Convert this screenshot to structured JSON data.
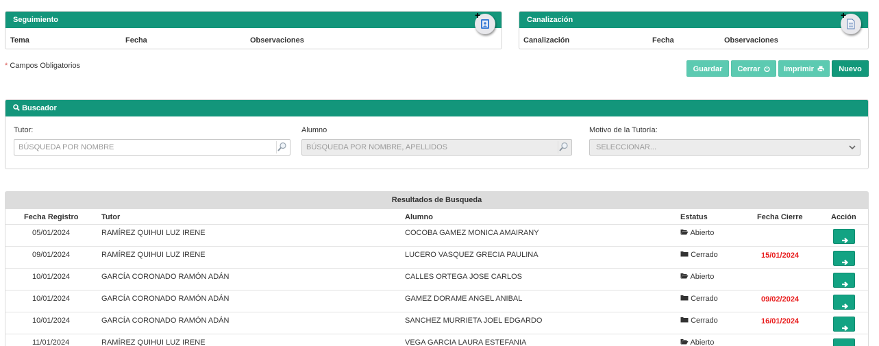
{
  "seguimiento": {
    "title": "Seguimiento",
    "columns": [
      "Tema",
      "Fecha",
      "Observaciones"
    ]
  },
  "canalizacion": {
    "title": "Canalización",
    "columns": [
      "Canalización",
      "Fecha",
      "Observaciones"
    ]
  },
  "required_note": "Campos Obligatorios",
  "toolbar": {
    "guardar": "Guardar",
    "cerrar": "Cerrar",
    "imprimir": "Imprimir",
    "nuevo": "Nuevo"
  },
  "buscador": {
    "title": "Buscador",
    "tutor_label": "Tutor:",
    "tutor_placeholder": "BÚSQUEDA POR NOMBRE",
    "alumno_label": "Alumno",
    "alumno_placeholder": "BÚSQUEDA POR NOMBRE, APELLIDOS",
    "motivo_label": "Motivo de la Tutoría:",
    "motivo_selected": "SELECCIONAR..."
  },
  "results": {
    "title": "Resultados de Busqueda",
    "headers": [
      "Fecha Registro",
      "Tutor",
      "Alumno",
      "Estatus",
      "Fecha Cierre",
      "Acción"
    ],
    "rows": [
      {
        "fecha": "05/01/2024",
        "tutor": "RAMÍREZ QUIHUI LUZ IRENE",
        "alumno": "COCOBA GAMEZ MONICA AMAIRANY",
        "estatus": "Abierto",
        "cierre": ""
      },
      {
        "fecha": "09/01/2024",
        "tutor": "RAMÍREZ QUIHUI LUZ IRENE",
        "alumno": "LUCERO VASQUEZ GRECIA PAULINA",
        "estatus": "Cerrado",
        "cierre": "15/01/2024"
      },
      {
        "fecha": "10/01/2024",
        "tutor": "GARCÍA CORONADO RAMÓN ADÁN",
        "alumno": "CALLES ORTEGA JOSE CARLOS",
        "estatus": "Abierto",
        "cierre": ""
      },
      {
        "fecha": "10/01/2024",
        "tutor": "GARCÍA CORONADO RAMÓN ADÁN",
        "alumno": "GAMEZ DORAME ANGEL ANIBAL",
        "estatus": "Cerrado",
        "cierre": "09/02/2024"
      },
      {
        "fecha": "10/01/2024",
        "tutor": "GARCÍA CORONADO RAMÓN ADÁN",
        "alumno": "SANCHEZ MURRIETA JOEL EDGARDO",
        "estatus": "Cerrado",
        "cierre": "16/01/2024"
      },
      {
        "fecha": "11/01/2024",
        "tutor": "RAMÍREZ QUIHUI LUZ IRENE",
        "alumno": "VEGA GARCIA LAURA ESTEFANIA",
        "estatus": "Abierto",
        "cierre": ""
      }
    ]
  },
  "colors": {
    "primary": "#13967b",
    "disabled_button": "#5ccab1",
    "close_date": "#e81b1b"
  }
}
